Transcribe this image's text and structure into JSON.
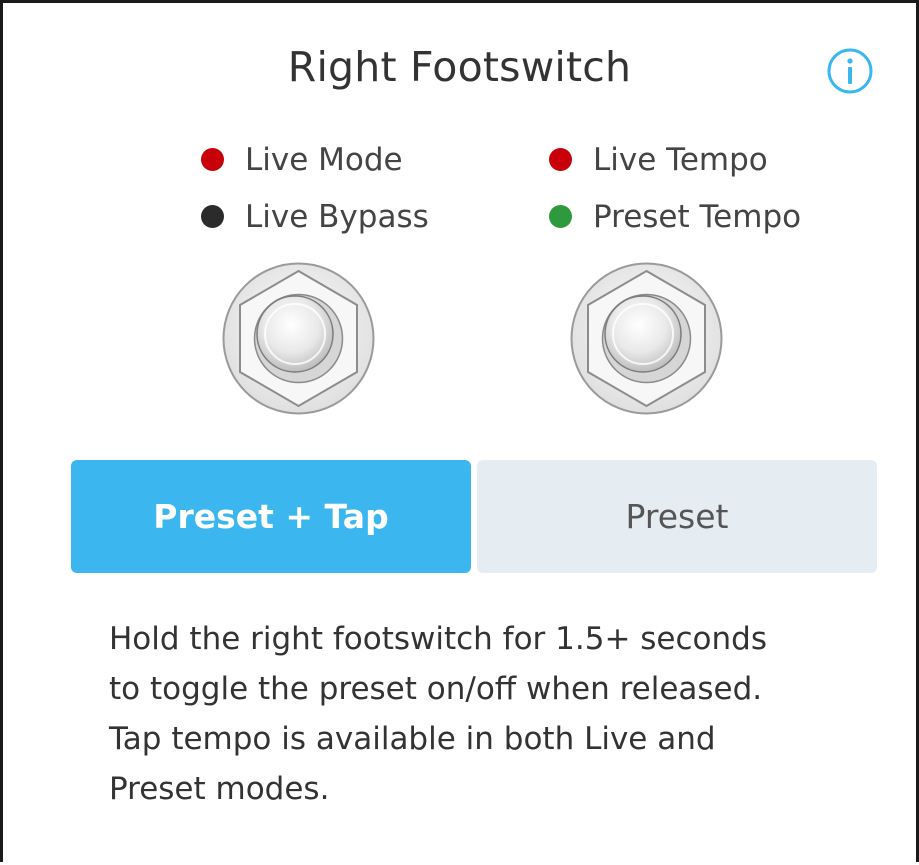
{
  "header": {
    "title": "Right Footswitch",
    "info_icon": "info-circle-icon"
  },
  "colors": {
    "accent": "#3cb6ee",
    "inactive_bg": "#e5edf2",
    "led_red": "#c8000a",
    "led_dark": "#2b2b2b",
    "led_green": "#2f9a3d"
  },
  "legend": {
    "left": [
      {
        "label": "Live Mode",
        "color": "#c8000a"
      },
      {
        "label": "Live Bypass",
        "color": "#2b2b2b"
      }
    ],
    "right": [
      {
        "label": "Live Tempo",
        "color": "#c8000a"
      },
      {
        "label": "Preset Tempo",
        "color": "#2f9a3d"
      }
    ]
  },
  "footswitches": [
    {
      "icon": "footswitch-icon"
    },
    {
      "icon": "footswitch-icon"
    }
  ],
  "modes": {
    "selected": "Preset + Tap",
    "options": [
      "Preset + Tap",
      "Preset"
    ]
  },
  "description": {
    "lines": [
      "Hold the right footswitch for 1.5+ seconds",
      "to toggle the preset on/off when released.",
      "Tap tempo is available in both Live and",
      "Preset modes."
    ]
  }
}
